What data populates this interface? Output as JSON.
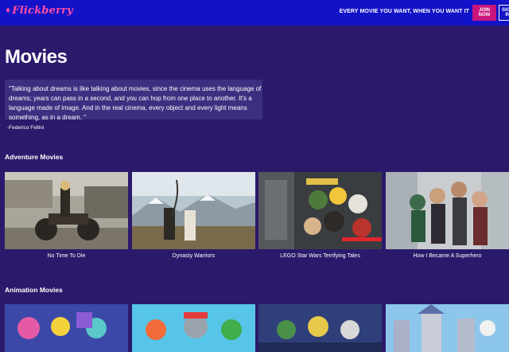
{
  "header": {
    "logo_text": "Flickberry",
    "tagline": "EVERY MOVIE YOU WANT, WHEN YOU WANT IT",
    "join_label": "JOIN NOW",
    "signin_label": "SIGN IN"
  },
  "page": {
    "title": "Movies",
    "quote": "\"Talking about dreams is like talking about movies, since the cinema uses the language of dreams; years can pass in a second, and you can hop from one place to another. It's a language made of image. And in the real cinema, every object and every light means something, as in a dream. \"",
    "quote_author": "-Federico Fellini"
  },
  "sections": [
    {
      "heading": "Adventure Movies",
      "movies": [
        {
          "title": "No Time To Die",
          "icon": "motorcycle-poster"
        },
        {
          "title": "Dynasty Warriors",
          "icon": "mountain-poster"
        },
        {
          "title": "LEGO Star Wars Terrifying Tales",
          "icon": "lego-poster"
        },
        {
          "title": "How I Became A Superhero",
          "icon": "superhero-poster"
        }
      ]
    },
    {
      "heading": "Animation Movies",
      "movies": [
        {
          "title": "",
          "icon": "animation-poster-1"
        },
        {
          "title": "",
          "icon": "animation-poster-2"
        },
        {
          "title": "",
          "icon": "animation-poster-3"
        },
        {
          "title": "",
          "icon": "animation-poster-4"
        }
      ]
    }
  ],
  "colors": {
    "header_bg": "#1212c8",
    "page_bg": "#2b1a6b",
    "quote_bg": "#3d2f80",
    "accent": "#c8157c",
    "logo": "#ff4fa3"
  }
}
